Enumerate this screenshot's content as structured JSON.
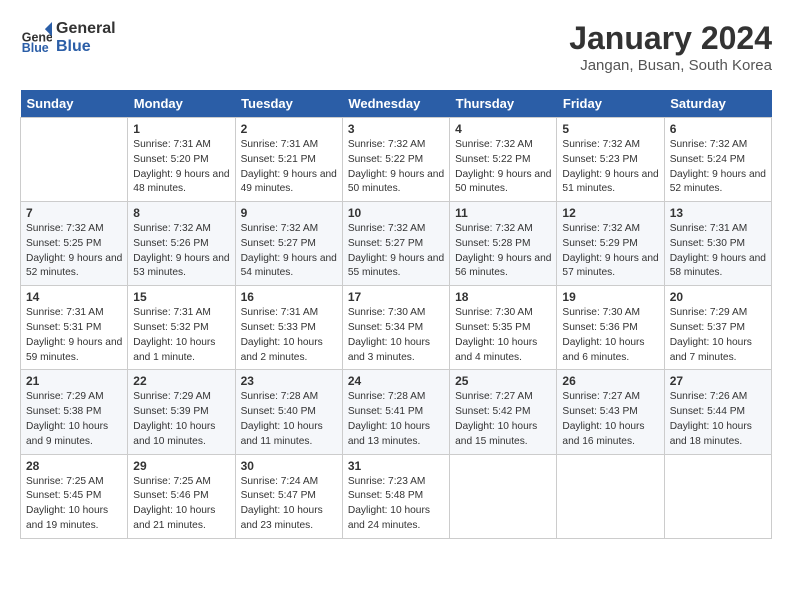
{
  "header": {
    "logo_general": "General",
    "logo_blue": "Blue",
    "month_year": "January 2024",
    "location": "Jangan, Busan, South Korea"
  },
  "days_of_week": [
    "Sunday",
    "Monday",
    "Tuesday",
    "Wednesday",
    "Thursday",
    "Friday",
    "Saturday"
  ],
  "weeks": [
    [
      {
        "num": "",
        "sunrise": "",
        "sunset": "",
        "daylight": ""
      },
      {
        "num": "1",
        "sunrise": "Sunrise: 7:31 AM",
        "sunset": "Sunset: 5:20 PM",
        "daylight": "Daylight: 9 hours and 48 minutes."
      },
      {
        "num": "2",
        "sunrise": "Sunrise: 7:31 AM",
        "sunset": "Sunset: 5:21 PM",
        "daylight": "Daylight: 9 hours and 49 minutes."
      },
      {
        "num": "3",
        "sunrise": "Sunrise: 7:32 AM",
        "sunset": "Sunset: 5:22 PM",
        "daylight": "Daylight: 9 hours and 50 minutes."
      },
      {
        "num": "4",
        "sunrise": "Sunrise: 7:32 AM",
        "sunset": "Sunset: 5:22 PM",
        "daylight": "Daylight: 9 hours and 50 minutes."
      },
      {
        "num": "5",
        "sunrise": "Sunrise: 7:32 AM",
        "sunset": "Sunset: 5:23 PM",
        "daylight": "Daylight: 9 hours and 51 minutes."
      },
      {
        "num": "6",
        "sunrise": "Sunrise: 7:32 AM",
        "sunset": "Sunset: 5:24 PM",
        "daylight": "Daylight: 9 hours and 52 minutes."
      }
    ],
    [
      {
        "num": "7",
        "sunrise": "Sunrise: 7:32 AM",
        "sunset": "Sunset: 5:25 PM",
        "daylight": "Daylight: 9 hours and 52 minutes."
      },
      {
        "num": "8",
        "sunrise": "Sunrise: 7:32 AM",
        "sunset": "Sunset: 5:26 PM",
        "daylight": "Daylight: 9 hours and 53 minutes."
      },
      {
        "num": "9",
        "sunrise": "Sunrise: 7:32 AM",
        "sunset": "Sunset: 5:27 PM",
        "daylight": "Daylight: 9 hours and 54 minutes."
      },
      {
        "num": "10",
        "sunrise": "Sunrise: 7:32 AM",
        "sunset": "Sunset: 5:27 PM",
        "daylight": "Daylight: 9 hours and 55 minutes."
      },
      {
        "num": "11",
        "sunrise": "Sunrise: 7:32 AM",
        "sunset": "Sunset: 5:28 PM",
        "daylight": "Daylight: 9 hours and 56 minutes."
      },
      {
        "num": "12",
        "sunrise": "Sunrise: 7:32 AM",
        "sunset": "Sunset: 5:29 PM",
        "daylight": "Daylight: 9 hours and 57 minutes."
      },
      {
        "num": "13",
        "sunrise": "Sunrise: 7:31 AM",
        "sunset": "Sunset: 5:30 PM",
        "daylight": "Daylight: 9 hours and 58 minutes."
      }
    ],
    [
      {
        "num": "14",
        "sunrise": "Sunrise: 7:31 AM",
        "sunset": "Sunset: 5:31 PM",
        "daylight": "Daylight: 9 hours and 59 minutes."
      },
      {
        "num": "15",
        "sunrise": "Sunrise: 7:31 AM",
        "sunset": "Sunset: 5:32 PM",
        "daylight": "Daylight: 10 hours and 1 minute."
      },
      {
        "num": "16",
        "sunrise": "Sunrise: 7:31 AM",
        "sunset": "Sunset: 5:33 PM",
        "daylight": "Daylight: 10 hours and 2 minutes."
      },
      {
        "num": "17",
        "sunrise": "Sunrise: 7:30 AM",
        "sunset": "Sunset: 5:34 PM",
        "daylight": "Daylight: 10 hours and 3 minutes."
      },
      {
        "num": "18",
        "sunrise": "Sunrise: 7:30 AM",
        "sunset": "Sunset: 5:35 PM",
        "daylight": "Daylight: 10 hours and 4 minutes."
      },
      {
        "num": "19",
        "sunrise": "Sunrise: 7:30 AM",
        "sunset": "Sunset: 5:36 PM",
        "daylight": "Daylight: 10 hours and 6 minutes."
      },
      {
        "num": "20",
        "sunrise": "Sunrise: 7:29 AM",
        "sunset": "Sunset: 5:37 PM",
        "daylight": "Daylight: 10 hours and 7 minutes."
      }
    ],
    [
      {
        "num": "21",
        "sunrise": "Sunrise: 7:29 AM",
        "sunset": "Sunset: 5:38 PM",
        "daylight": "Daylight: 10 hours and 9 minutes."
      },
      {
        "num": "22",
        "sunrise": "Sunrise: 7:29 AM",
        "sunset": "Sunset: 5:39 PM",
        "daylight": "Daylight: 10 hours and 10 minutes."
      },
      {
        "num": "23",
        "sunrise": "Sunrise: 7:28 AM",
        "sunset": "Sunset: 5:40 PM",
        "daylight": "Daylight: 10 hours and 11 minutes."
      },
      {
        "num": "24",
        "sunrise": "Sunrise: 7:28 AM",
        "sunset": "Sunset: 5:41 PM",
        "daylight": "Daylight: 10 hours and 13 minutes."
      },
      {
        "num": "25",
        "sunrise": "Sunrise: 7:27 AM",
        "sunset": "Sunset: 5:42 PM",
        "daylight": "Daylight: 10 hours and 15 minutes."
      },
      {
        "num": "26",
        "sunrise": "Sunrise: 7:27 AM",
        "sunset": "Sunset: 5:43 PM",
        "daylight": "Daylight: 10 hours and 16 minutes."
      },
      {
        "num": "27",
        "sunrise": "Sunrise: 7:26 AM",
        "sunset": "Sunset: 5:44 PM",
        "daylight": "Daylight: 10 hours and 18 minutes."
      }
    ],
    [
      {
        "num": "28",
        "sunrise": "Sunrise: 7:25 AM",
        "sunset": "Sunset: 5:45 PM",
        "daylight": "Daylight: 10 hours and 19 minutes."
      },
      {
        "num": "29",
        "sunrise": "Sunrise: 7:25 AM",
        "sunset": "Sunset: 5:46 PM",
        "daylight": "Daylight: 10 hours and 21 minutes."
      },
      {
        "num": "30",
        "sunrise": "Sunrise: 7:24 AM",
        "sunset": "Sunset: 5:47 PM",
        "daylight": "Daylight: 10 hours and 23 minutes."
      },
      {
        "num": "31",
        "sunrise": "Sunrise: 7:23 AM",
        "sunset": "Sunset: 5:48 PM",
        "daylight": "Daylight: 10 hours and 24 minutes."
      },
      {
        "num": "",
        "sunrise": "",
        "sunset": "",
        "daylight": ""
      },
      {
        "num": "",
        "sunrise": "",
        "sunset": "",
        "daylight": ""
      },
      {
        "num": "",
        "sunrise": "",
        "sunset": "",
        "daylight": ""
      }
    ]
  ]
}
